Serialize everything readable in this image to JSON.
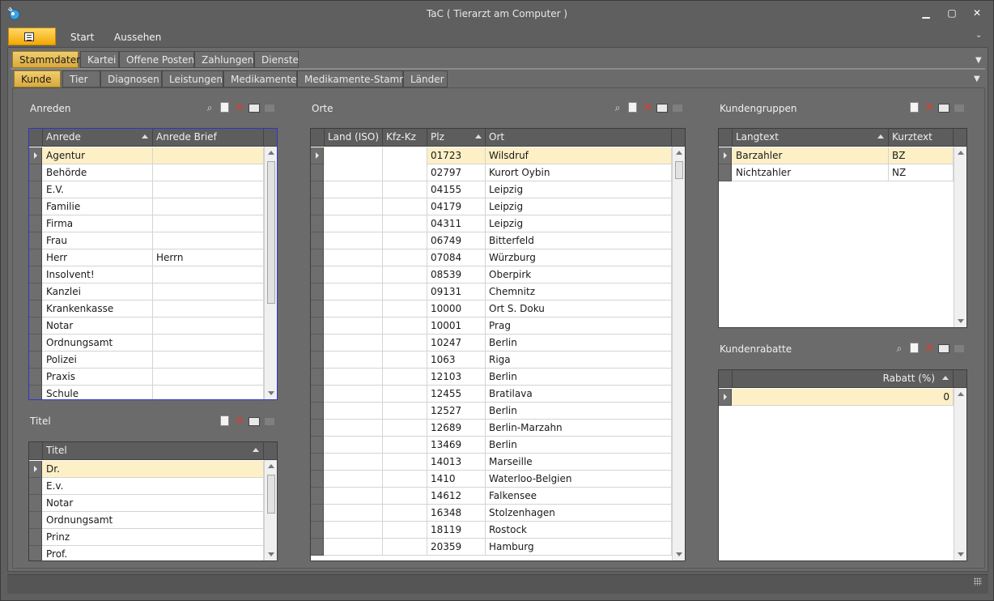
{
  "window": {
    "title": "TaC ( Tierarzt am Computer )",
    "min": "▁",
    "max": "▢",
    "close": "✕"
  },
  "menu": {
    "items": [
      "Start",
      "Aussehen"
    ]
  },
  "tabs_main": [
    "Stammdaten",
    "Kartei",
    "Offene Posten",
    "Zahlungen",
    "Dienste"
  ],
  "tabs_sub": [
    "Kunde",
    "Tier",
    "Diagnosen",
    "Leistungen",
    "Medikamente",
    "Medikamente-Stamm",
    "Länder"
  ],
  "anreden": {
    "title": "Anreden",
    "columns": [
      "Anrede",
      "Anrede Brief"
    ],
    "rows": [
      [
        "Agentur",
        ""
      ],
      [
        "Behörde",
        ""
      ],
      [
        "E.V.",
        ""
      ],
      [
        "Familie",
        ""
      ],
      [
        "Firma",
        ""
      ],
      [
        "Frau",
        ""
      ],
      [
        "Herr",
        "Herrn"
      ],
      [
        "Insolvent!",
        ""
      ],
      [
        "Kanzlei",
        ""
      ],
      [
        "Krankenkasse",
        ""
      ],
      [
        "Notar",
        ""
      ],
      [
        "Ordnungsamt",
        ""
      ],
      [
        "Polizei",
        ""
      ],
      [
        "Praxis",
        ""
      ],
      [
        "Schule",
        ""
      ]
    ]
  },
  "titel": {
    "title": "Titel",
    "columns": [
      "Titel"
    ],
    "rows": [
      [
        "Dr."
      ],
      [
        "E.v."
      ],
      [
        "Notar"
      ],
      [
        "Ordnungsamt"
      ],
      [
        "Prinz"
      ],
      [
        "Prof."
      ]
    ]
  },
  "orte": {
    "title": "Orte",
    "columns": [
      "Land (ISO)",
      "Kfz-Kz",
      "Plz",
      "Ort"
    ],
    "rows": [
      [
        "",
        "",
        "01723",
        "Wilsdruf"
      ],
      [
        "",
        "",
        "02797",
        "Kurort Oybin"
      ],
      [
        "",
        "",
        "04155",
        "Leipzig"
      ],
      [
        "",
        "",
        "04179",
        "Leipzig"
      ],
      [
        "",
        "",
        "04311",
        "Leipzig"
      ],
      [
        "",
        "",
        "06749",
        "Bitterfeld"
      ],
      [
        "",
        "",
        "07084",
        "Würzburg"
      ],
      [
        "",
        "",
        "08539",
        "Oberpirk"
      ],
      [
        "",
        "",
        "09131",
        "Chemnitz"
      ],
      [
        "",
        "",
        "10000",
        "Ort S. Doku"
      ],
      [
        "",
        "",
        "10001",
        "Prag"
      ],
      [
        "",
        "",
        "10247",
        "Berlin"
      ],
      [
        "",
        "",
        "1063",
        "Riga"
      ],
      [
        "",
        "",
        "12103",
        "Berlin"
      ],
      [
        "",
        "",
        "12455",
        "Bratilava"
      ],
      [
        "",
        "",
        "12527",
        "Berlin"
      ],
      [
        "",
        "",
        "12689",
        "Berlin-Marzahn"
      ],
      [
        "",
        "",
        "13469",
        "Berlin"
      ],
      [
        "",
        "",
        "14013",
        "Marseille"
      ],
      [
        "",
        "",
        "1410",
        "Waterloo-Belgien"
      ],
      [
        "",
        "",
        "14612",
        "Falkensee"
      ],
      [
        "",
        "",
        "16348",
        "Stolzenhagen"
      ],
      [
        "",
        "",
        "18119",
        "Rostock"
      ],
      [
        "",
        "",
        "20359",
        "Hamburg"
      ]
    ]
  },
  "kundengruppen": {
    "title": "Kundengruppen",
    "columns": [
      "Langtext",
      "Kurztext"
    ],
    "rows": [
      [
        "Barzahler",
        "BZ"
      ],
      [
        "Nichtzahler",
        "NZ"
      ]
    ]
  },
  "kundenrabatte": {
    "title": "Kundenrabatte",
    "columns": [
      "Rabatt (%)"
    ],
    "rows": [
      [
        "0"
      ]
    ]
  },
  "icons": [
    "app-logo-icon",
    "app-menu-icon",
    "binoculars-icon",
    "new-document-icon",
    "delete-icon",
    "print-icon",
    "export-icon"
  ],
  "colors": {
    "accent": "#f4b000",
    "selected_row": "#fdf0c6",
    "focus_border": "#3333cc",
    "delete": "#e03a2a"
  }
}
